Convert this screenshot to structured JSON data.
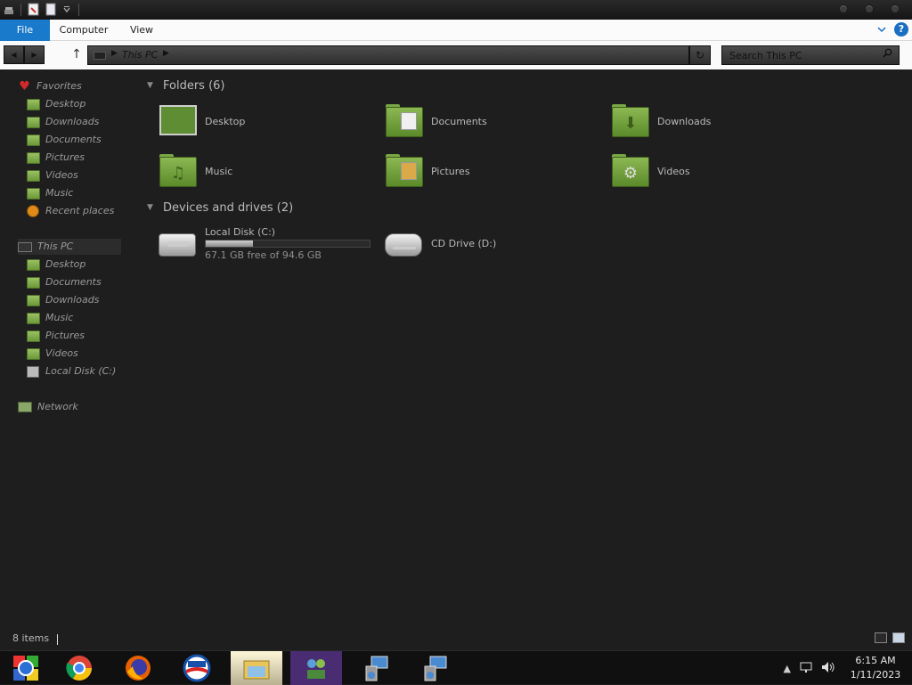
{
  "ribbon": {
    "tabs": [
      "File",
      "Computer",
      "View"
    ]
  },
  "address": {
    "path": [
      "This PC"
    ]
  },
  "search": {
    "placeholder": "Search This PC"
  },
  "sidebar": {
    "favorites_label": "Favorites",
    "favorites": [
      "Desktop",
      "Downloads",
      "Documents",
      "Pictures",
      "Videos",
      "Music",
      "Recent places"
    ],
    "this_pc_label": "This PC",
    "this_pc": [
      "Desktop",
      "Documents",
      "Downloads",
      "Music",
      "Pictures",
      "Videos",
      "Local Disk (C:)"
    ],
    "network_label": "Network"
  },
  "content": {
    "folders_header": "Folders (6)",
    "folders": [
      "Desktop",
      "Documents",
      "Downloads",
      "Music",
      "Pictures",
      "Videos"
    ],
    "devices_header": "Devices and drives (2)",
    "drives": [
      {
        "name": "Local Disk (C:)",
        "free_text": "67.1 GB free of 94.6 GB",
        "used_fraction": 0.29
      },
      {
        "name": "CD Drive (D:)"
      }
    ]
  },
  "status": {
    "items": "8 items"
  },
  "taskbar": {
    "apps": [
      "start-icon",
      "chrome-icon",
      "firefox-icon",
      "opera-icon",
      "file-explorer-icon",
      "people-icon",
      "remote-desktop-icon",
      "remote-desktop-icon"
    ],
    "time": "6:15 AM",
    "date": "1/11/2023"
  },
  "colors": {
    "accent": "#1979ca",
    "folder_green": "#8cb853",
    "background": "#1e1e1e"
  }
}
